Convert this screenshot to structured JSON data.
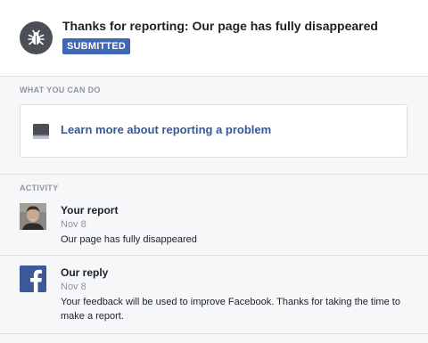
{
  "header": {
    "title": "Thanks for reporting: Our page has fully disappeared",
    "status": "SUBMITTED",
    "icon": "bug-icon"
  },
  "what_you_can_do": {
    "heading": "WHAT YOU CAN DO",
    "learn_more": {
      "label": "Learn more about reporting a problem",
      "icon": "book-icon"
    }
  },
  "activity": {
    "heading": "ACTIVITY",
    "items": [
      {
        "title": "Your report",
        "date": "Nov 8",
        "text": "Our page has fully disappeared",
        "icon": "user-avatar"
      },
      {
        "title": "Our reply",
        "date": "Nov 8",
        "text": "Your feedback will be used to improve Facebook. Thanks for taking the time to make a report.",
        "icon": "facebook-logo-icon"
      }
    ]
  },
  "colors": {
    "brand_blue": "#4267b2",
    "link_blue": "#365899",
    "facebook_blue": "#3b5998",
    "muted_text": "#90949c",
    "section_bg": "#f6f7f9",
    "divider": "#dddfe2"
  }
}
